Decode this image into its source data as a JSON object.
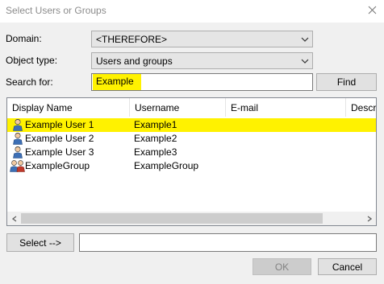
{
  "window": {
    "title": "Select Users or Groups"
  },
  "colors": {
    "highlight": "#fff200",
    "bg": "#f0f0f0",
    "disabled_text": "#838383"
  },
  "form": {
    "domain_label": "Domain:",
    "domain_value": "<THEREFORE>",
    "object_type_label": "Object type:",
    "object_type_value": "Users and groups",
    "search_label": "Search for:",
    "search_value": "Example",
    "find_label": "Find"
  },
  "table": {
    "columns": [
      "Display Name",
      "Username",
      "E-mail",
      "Descrip"
    ],
    "rows": [
      {
        "icon": "user-icon",
        "display_name": "Example User 1",
        "username": "Example1",
        "email": ""
      },
      {
        "icon": "user-icon",
        "display_name": "Example User 2",
        "username": "Example2",
        "email": ""
      },
      {
        "icon": "user-icon",
        "display_name": "Example User 3",
        "username": "Example3",
        "email": ""
      },
      {
        "icon": "group-icon",
        "display_name": "ExampleGroup",
        "username": "ExampleGroup",
        "email": ""
      }
    ]
  },
  "footer": {
    "select_label": "Select -->",
    "selected_value": "",
    "ok_label": "OK",
    "cancel_label": "Cancel"
  }
}
